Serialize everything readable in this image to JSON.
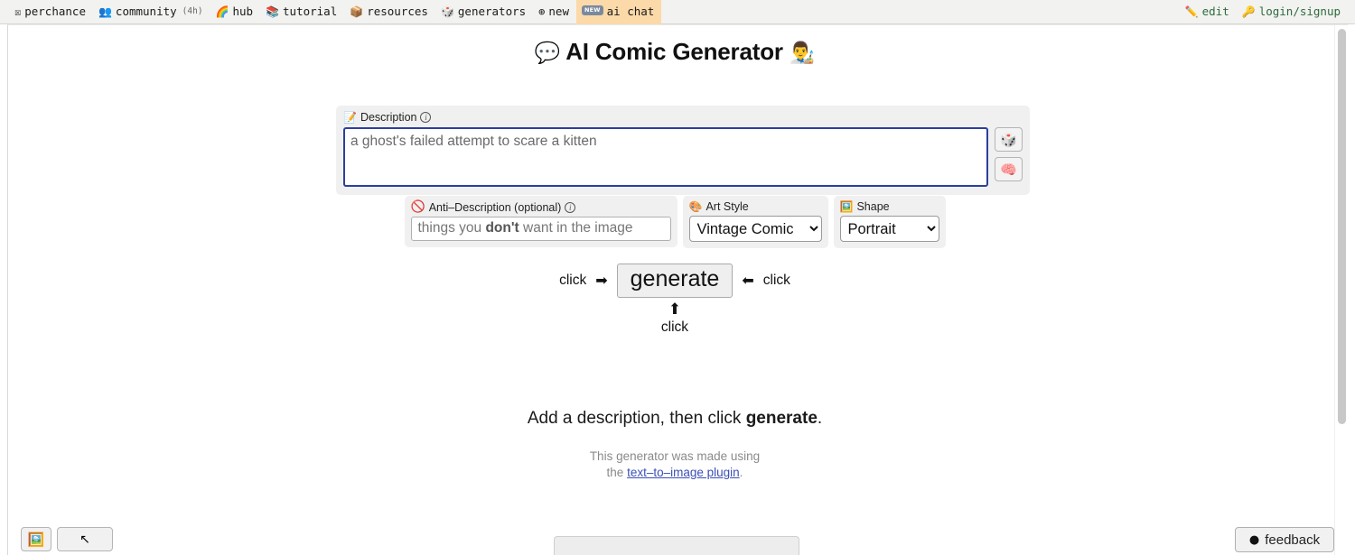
{
  "nav": {
    "left_items": [
      {
        "icon": "perchance-logo-icon",
        "glyph": "☒",
        "label": "perchance",
        "sub": "",
        "highlight": false,
        "badge": ""
      },
      {
        "icon": "people-icon",
        "glyph": "👥",
        "label": "community",
        "sub": "(4h)",
        "highlight": false,
        "badge": ""
      },
      {
        "icon": "rainbow-icon",
        "glyph": "🌈",
        "label": "hub",
        "sub": "",
        "highlight": false,
        "badge": ""
      },
      {
        "icon": "books-icon",
        "glyph": "📚",
        "label": "tutorial",
        "sub": "",
        "highlight": false,
        "badge": ""
      },
      {
        "icon": "package-icon",
        "glyph": "📦",
        "label": "resources",
        "sub": "",
        "highlight": false,
        "badge": ""
      },
      {
        "icon": "dice-icon",
        "glyph": "🎲",
        "label": "generators",
        "sub": "",
        "highlight": false,
        "badge": ""
      },
      {
        "icon": "plus-circle-icon",
        "glyph": "⊕",
        "label": "new",
        "sub": "",
        "highlight": false,
        "badge": ""
      },
      {
        "icon": "ai-chat-icon",
        "glyph": "",
        "label": "ai chat",
        "sub": "",
        "highlight": true,
        "badge": "NEW"
      }
    ],
    "right_items": [
      {
        "icon": "pencil-icon",
        "glyph": "✏️",
        "label": "edit"
      },
      {
        "icon": "key-icon",
        "glyph": "🔑",
        "label": "login/signup"
      }
    ]
  },
  "page": {
    "title_emoji_left": "💬",
    "title_text": "AI Comic Generator",
    "title_emoji_right": "👨‍🎨"
  },
  "description": {
    "label_emoji": "📝",
    "label": "Description",
    "info": "i",
    "value": "a ghost's failed attempt to scare a kitten",
    "placeholder": "a ghost's failed attempt to scare a kitten",
    "random_button": {
      "name": "dice-icon",
      "glyph": "🎲"
    },
    "ai_button": {
      "name": "brain-icon",
      "glyph": "🧠"
    }
  },
  "anti_description": {
    "label_icon": "🚫",
    "label": "Anti–Description (optional)",
    "info": "i",
    "value": "",
    "placeholder_pre": "things you ",
    "placeholder_bold": "don't",
    "placeholder_post": " want in the image"
  },
  "art_style": {
    "label_emoji": "🎨",
    "label": "Art Style",
    "selected": "Vintage Comic",
    "options": [
      "Vintage Comic"
    ]
  },
  "shape": {
    "label_emoji": "🖼️",
    "label": "Shape",
    "selected": "Portrait",
    "options": [
      "Portrait"
    ]
  },
  "generate": {
    "left_click_label": "click",
    "left_arrow": "➡",
    "button_label": "generate",
    "right_arrow": "⬅",
    "right_click_label": "click",
    "up_arrow": "⬆",
    "below_click_label": "click"
  },
  "status": {
    "main_pre": "Add a description, then click ",
    "main_bold": "generate",
    "main_post": ".",
    "credit_line1": "This generator was made using",
    "credit_line2_pre": "the ",
    "credit_link": "text–to–image plugin",
    "credit_line2_post": "."
  },
  "bottom": {
    "gallery_button": {
      "name": "gallery-icon",
      "glyph": "🖼️"
    },
    "cursor_button": {
      "name": "cursor-arrow-icon",
      "glyph": "↖"
    },
    "feedback_icon": "●",
    "feedback_label": "feedback"
  },
  "colors": {
    "nav_bg": "#f2f2f0",
    "nav_highlight": "#fcd9a8",
    "panel_bg": "#f0f0f0",
    "focus_border": "#2b3f9e",
    "link": "#3b4fb5",
    "muted_text": "#8a8a8a"
  }
}
